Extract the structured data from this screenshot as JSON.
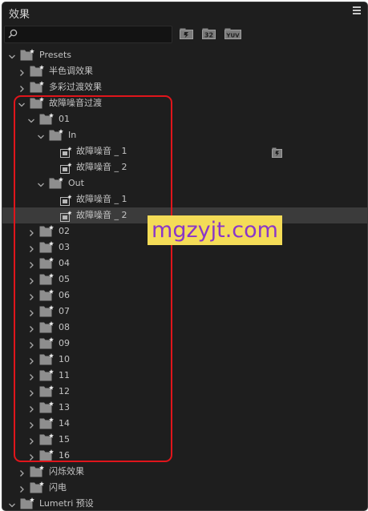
{
  "panel": {
    "title": "效果"
  },
  "search": {
    "value": "",
    "placeholder": ""
  },
  "filters": [
    {
      "label": "",
      "icon": "accelerated-effects-icon"
    },
    {
      "label": "32",
      "icon": "32-bit-color-icon"
    },
    {
      "label": "YUV",
      "icon": "yuv-effects-icon"
    }
  ],
  "tree": [
    {
      "label": "Presets",
      "level": 0,
      "type": "folder",
      "expanded": true
    },
    {
      "label": "半色调效果",
      "level": 1,
      "type": "folder",
      "expanded": false
    },
    {
      "label": "多彩过渡效果",
      "level": 1,
      "type": "folder",
      "expanded": false
    },
    {
      "label": "故障噪音过渡",
      "level": 1,
      "type": "folder",
      "expanded": true
    },
    {
      "label": "01",
      "level": 2,
      "type": "folder",
      "expanded": true
    },
    {
      "label": "In",
      "level": 3,
      "type": "folder",
      "expanded": true
    },
    {
      "label": "故障噪音 _ 1",
      "level": 4,
      "type": "preset",
      "accelerated": true
    },
    {
      "label": "故障噪音 _ 2",
      "level": 4,
      "type": "preset"
    },
    {
      "label": "Out",
      "level": 3,
      "type": "folder",
      "expanded": true
    },
    {
      "label": "故障噪音 _ 1",
      "level": 4,
      "type": "preset"
    },
    {
      "label": "故障噪音 _ 2",
      "level": 4,
      "type": "preset",
      "selected": true
    },
    {
      "label": "02",
      "level": 2,
      "type": "folder",
      "expanded": false
    },
    {
      "label": "03",
      "level": 2,
      "type": "folder",
      "expanded": false
    },
    {
      "label": "04",
      "level": 2,
      "type": "folder",
      "expanded": false
    },
    {
      "label": "05",
      "level": 2,
      "type": "folder",
      "expanded": false
    },
    {
      "label": "06",
      "level": 2,
      "type": "folder",
      "expanded": false
    },
    {
      "label": "07",
      "level": 2,
      "type": "folder",
      "expanded": false
    },
    {
      "label": "08",
      "level": 2,
      "type": "folder",
      "expanded": false
    },
    {
      "label": "09",
      "level": 2,
      "type": "folder",
      "expanded": false
    },
    {
      "label": "10",
      "level": 2,
      "type": "folder",
      "expanded": false
    },
    {
      "label": "11",
      "level": 2,
      "type": "folder",
      "expanded": false
    },
    {
      "label": "12",
      "level": 2,
      "type": "folder",
      "expanded": false
    },
    {
      "label": "13",
      "level": 2,
      "type": "folder",
      "expanded": false
    },
    {
      "label": "14",
      "level": 2,
      "type": "folder",
      "expanded": false
    },
    {
      "label": "15",
      "level": 2,
      "type": "folder",
      "expanded": false
    },
    {
      "label": "16",
      "level": 2,
      "type": "folder",
      "expanded": false
    },
    {
      "label": "闪烁效果",
      "level": 1,
      "type": "folder",
      "expanded": false
    },
    {
      "label": "闪电",
      "level": 1,
      "type": "folder",
      "expanded": false
    },
    {
      "label": "Lumetri 预设",
      "level": 0,
      "type": "folder",
      "expanded": true
    }
  ],
  "watermark": {
    "text": "mgzyjt.com"
  },
  "colors": {
    "panel_bg": "#1e1e1e",
    "selected_row": "#3b3b3b",
    "highlight_border": "#e0151b",
    "watermark_bg": "#f4dc57",
    "watermark_text": "#8a36c9"
  }
}
